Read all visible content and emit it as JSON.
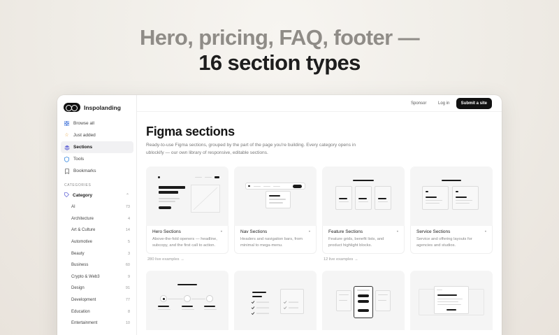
{
  "hero": {
    "line1": "Hero, pricing, FAQ, footer —",
    "line2": "16 section types"
  },
  "brand": {
    "name": "Inspolanding"
  },
  "nav": [
    {
      "label": "Browse all",
      "icon": "grid-icon"
    },
    {
      "label": "Just added",
      "icon": "star-icon"
    },
    {
      "label": "Sections",
      "icon": "layers-icon"
    },
    {
      "label": "Tools",
      "icon": "shield-icon"
    },
    {
      "label": "Bookmarks",
      "icon": "bookmark-icon"
    }
  ],
  "categories": {
    "heading": "CATEGORIES",
    "group_label": "Category",
    "items": [
      {
        "label": "AI",
        "count": "73"
      },
      {
        "label": "Architecture",
        "count": "4"
      },
      {
        "label": "Art & Culture",
        "count": "14"
      },
      {
        "label": "Automotive",
        "count": "5"
      },
      {
        "label": "Beauty",
        "count": "3"
      },
      {
        "label": "Business",
        "count": "60"
      },
      {
        "label": "Crypto & Web3",
        "count": "9"
      },
      {
        "label": "Design",
        "count": "91"
      },
      {
        "label": "Development",
        "count": "77"
      },
      {
        "label": "Education",
        "count": "8"
      },
      {
        "label": "Entertainment",
        "count": "10"
      }
    ]
  },
  "topbar": {
    "sponsor": "Sponsor",
    "login": "Log in",
    "submit": "Submit a site"
  },
  "main": {
    "title": "Figma sections",
    "description": "Ready-to-use Figma sections, grouped by the part of the page you're building. Every category opens in ublockify — our own library of responsive, editable sections."
  },
  "cards": [
    {
      "title": "Hero Sections",
      "desc": "Above-the-fold openers — headline, subcopy, and the first call to action.",
      "examples": "280 live examples →"
    },
    {
      "title": "Nav Sections",
      "desc": "Headers and navigation bars, from minimal to mega-menu.",
      "examples": ""
    },
    {
      "title": "Feature Sections",
      "desc": "Feature grids, benefit lists, and product highlight blocks.",
      "examples": "12 live examples →"
    },
    {
      "title": "Service Sections",
      "desc": "Service and offering layouts for agencies and studios.",
      "examples": ""
    }
  ]
}
